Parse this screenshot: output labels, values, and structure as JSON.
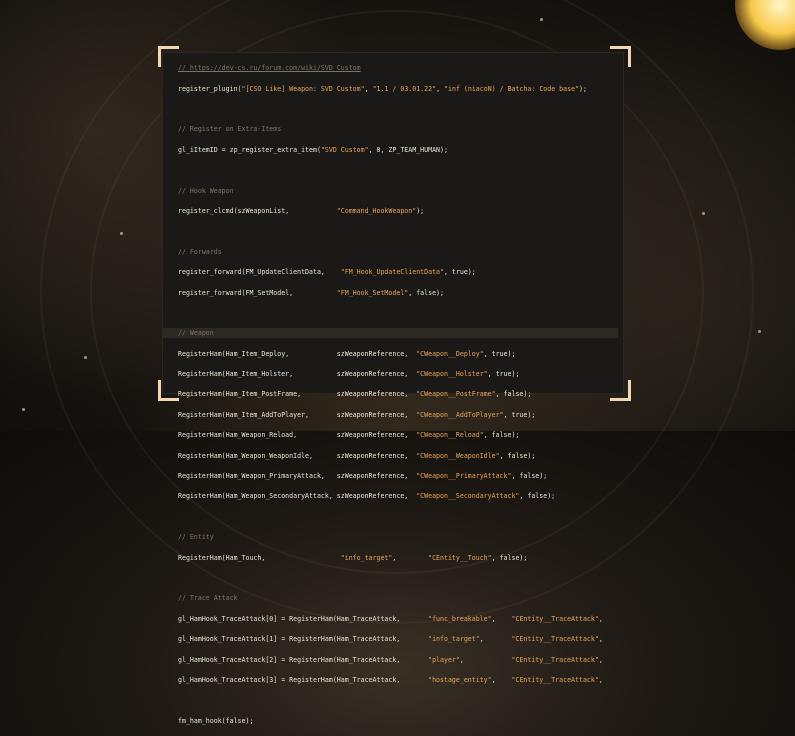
{
  "code": {
    "url_comment": "// https://dev-cs.ru/forum.com/wiki/SVD_Custom",
    "register_plugin": {
      "pre": "register_plugin(",
      "s1": "\"[CSO Like] Weapon: SVD Custom\"",
      "mid1": ", ",
      "s2": "\"1.1 / 03.01.22\"",
      "mid2": ", ",
      "s3": "\"inf (niacoN) / Batcha: Code base\"",
      "post": ");"
    },
    "comment_extra": "// Register on Extra-Items",
    "extra_item": {
      "pre": "gl_iItemID = zp_register_extra_item(",
      "s1": "\"SVD Custom\"",
      "post": ", 0, ZP_TEAM_HUMAN);"
    },
    "comment_hook": "// Hook Weapon",
    "clcmd": {
      "pre": "register_clcmd(szWeaponList,            ",
      "s1": "\"Command_HookWeapon\"",
      "post": ");"
    },
    "comment_forwards": "// Forwards",
    "forward1": {
      "pre": "register_forward(FM_UpdateClientData,    ",
      "s1": "\"FM_Hook_UpdateClientData\"",
      "post": ", true);"
    },
    "forward2": {
      "pre": "register_forward(FM_SetModel,           ",
      "s1": "\"FM_Hook_SetModel\"",
      "post": ", false);"
    },
    "comment_weapon": "// Weapon",
    "ham_weapon": [
      {
        "pre": "RegisterHam(Ham_Item_Deploy,            szWeaponReference,  ",
        "s1": "\"CWeapon__Deploy\"",
        "post": ", true);"
      },
      {
        "pre": "RegisterHam(Ham_Item_Holster,           szWeaponReference,  ",
        "s1": "\"CWeapon__Holster\"",
        "post": ", true);"
      },
      {
        "pre": "RegisterHam(Ham_Item_PostFrame,         szWeaponReference,  ",
        "s1": "\"CWeapon__PostFrame\"",
        "post": ", false);"
      },
      {
        "pre": "RegisterHam(Ham_Item_AddToPlayer,       szWeaponReference,  ",
        "s1": "\"CWeapon__AddToPlayer\"",
        "post": ", true);"
      },
      {
        "pre": "RegisterHam(Ham_Weapon_Reload,          szWeaponReference,  ",
        "s1": "\"CWeapon__Reload\"",
        "post": ", false);"
      },
      {
        "pre": "RegisterHam(Ham_Weapon_WeaponIdle,      szWeaponReference,  ",
        "s1": "\"CWeapon__WeaponIdle\"",
        "post": ", false);"
      },
      {
        "pre": "RegisterHam(Ham_Weapon_PrimaryAttack,   szWeaponReference,  ",
        "s1": "\"CWeapon__PrimaryAttack\"",
        "post": ", false);"
      },
      {
        "pre": "RegisterHam(Ham_Weapon_SecondaryAttack, szWeaponReference,  ",
        "s1": "\"CWeapon__SecondaryAttack\"",
        "post": ", false);"
      }
    ],
    "comment_entity": "// Entity",
    "ham_touch": {
      "pre": "RegisterHam(Ham_Touch,                   ",
      "s1": "\"info_target\"",
      "mid": ",        ",
      "s2": "\"CEntity__Touch\"",
      "post": ", false);"
    },
    "comment_trace": "// Trace Attack",
    "trace": [
      {
        "pre": "gl_HamHook_TraceAttack[0] = RegisterHam(Ham_TraceAttack,       ",
        "s1": "\"func_breakable\"",
        "mid": ",    ",
        "s2": "\"CEntity__TraceAttack\"",
        "post": ","
      },
      {
        "pre": "gl_HamHook_TraceAttack[1] = RegisterHam(Ham_TraceAttack,       ",
        "s1": "\"info_target\"",
        "mid": ",       ",
        "s2": "\"CEntity__TraceAttack\"",
        "post": ","
      },
      {
        "pre": "gl_HamHook_TraceAttack[2] = RegisterHam(Ham_TraceAttack,       ",
        "s1": "\"player\"",
        "mid": ",            ",
        "s2": "\"CEntity__TraceAttack\"",
        "post": ","
      },
      {
        "pre": "gl_HamHook_TraceAttack[3] = RegisterHam(Ham_TraceAttack,       ",
        "s1": "\"hostage_entity\"",
        "mid": ",    ",
        "s2": "\"CEntity__TraceAttack\"",
        "post": ","
      }
    ],
    "final": "fm_ham_hook(false);"
  },
  "colors": {
    "text": "#ece3d3",
    "string": "#e7a45c",
    "comment": "#7d7468",
    "corner": "#f3d7b0"
  }
}
